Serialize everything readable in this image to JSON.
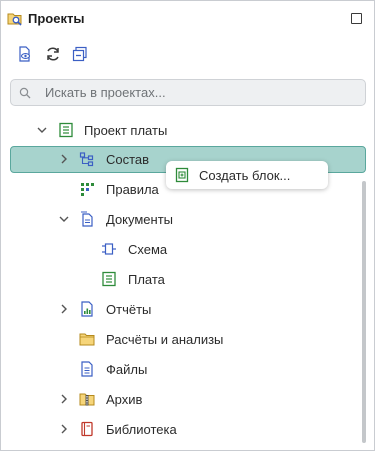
{
  "panel": {
    "title": "Проекты"
  },
  "toolbar": {
    "buttons": [
      {
        "icon": "show-project-icon"
      },
      {
        "icon": "refresh-icon"
      },
      {
        "icon": "collapse-all-icon"
      }
    ]
  },
  "search": {
    "placeholder": "Искать в проектах...",
    "value": ""
  },
  "tree": {
    "items": [
      {
        "label": "Проект платы",
        "icon": "board-project-icon",
        "expanded": true
      },
      {
        "label": "Состав",
        "icon": "structure-icon",
        "expanded": false,
        "selected": true
      },
      {
        "label": "Правила",
        "icon": "rules-icon"
      },
      {
        "label": "Документы",
        "icon": "documents-icon",
        "expanded": true
      },
      {
        "label": "Схема",
        "icon": "schematic-icon"
      },
      {
        "label": "Плата",
        "icon": "board-icon"
      },
      {
        "label": "Отчёты",
        "icon": "reports-icon",
        "expanded": false
      },
      {
        "label": "Расчёты и анализы",
        "icon": "folder-icon"
      },
      {
        "label": "Файлы",
        "icon": "files-icon"
      },
      {
        "label": "Архив",
        "icon": "archive-icon",
        "expanded": false
      },
      {
        "label": "Библиотека",
        "icon": "library-icon",
        "expanded": false
      }
    ]
  },
  "context_menu": {
    "items": [
      {
        "label": "Создать блок...",
        "icon": "create-block-icon"
      }
    ]
  },
  "colors": {
    "selection_bg": "#a7d3cd",
    "selection_border": "#5aa79d",
    "icon_blue": "#3b5fc4",
    "icon_green": "#2e8b3a"
  }
}
